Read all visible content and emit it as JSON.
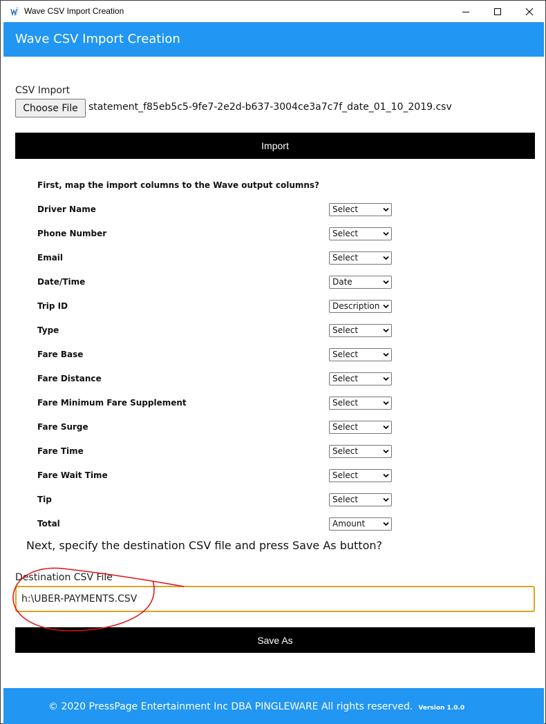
{
  "window": {
    "title": "Wave CSV Import Creation",
    "controls": {
      "minimize": "minimize",
      "maximize": "maximize",
      "close": "close"
    }
  },
  "header": {
    "title": "Wave CSV Import Creation"
  },
  "import_section": {
    "label": "CSV Import",
    "choose_file_label": "Choose File",
    "file_name": "statement_f85eb5c5-9fe7-2e2d-b637-3004ce3a7c7f_date_01_10_2019.csv",
    "import_button": "Import"
  },
  "mapping": {
    "heading": "First, map the import columns to the Wave output columns?",
    "rows": [
      {
        "label": "Driver Name",
        "value": "Select"
      },
      {
        "label": "Phone Number",
        "value": "Select"
      },
      {
        "label": "Email",
        "value": "Select"
      },
      {
        "label": "Date/Time",
        "value": "Date"
      },
      {
        "label": "Trip ID",
        "value": "Description"
      },
      {
        "label": "Type",
        "value": "Select"
      },
      {
        "label": "Fare Base",
        "value": "Select"
      },
      {
        "label": "Fare Distance",
        "value": "Select"
      },
      {
        "label": "Fare Minimum Fare Supplement",
        "value": "Select"
      },
      {
        "label": "Fare Surge",
        "value": "Select"
      },
      {
        "label": "Fare Time",
        "value": "Select"
      },
      {
        "label": "Fare Wait Time",
        "value": "Select"
      },
      {
        "label": "Tip",
        "value": "Select"
      },
      {
        "label": "Total",
        "value": "Amount"
      }
    ]
  },
  "destination": {
    "instruction": "Next, specify the destination CSV file and press Save As button?",
    "label": "Destination CSV File",
    "value": "h:\\UBER-PAYMENTS.CSV",
    "save_button": "Save As"
  },
  "footer": {
    "copyright": "© 2020 PressPage Entertainment Inc DBA PINGLEWARE  All rights reserved.",
    "version": "Version 1.0.0"
  },
  "colors": {
    "accent": "#2196f3",
    "input_focus_border": "#e0a21a",
    "button_bg": "#000000",
    "annotation": "#e01010"
  }
}
